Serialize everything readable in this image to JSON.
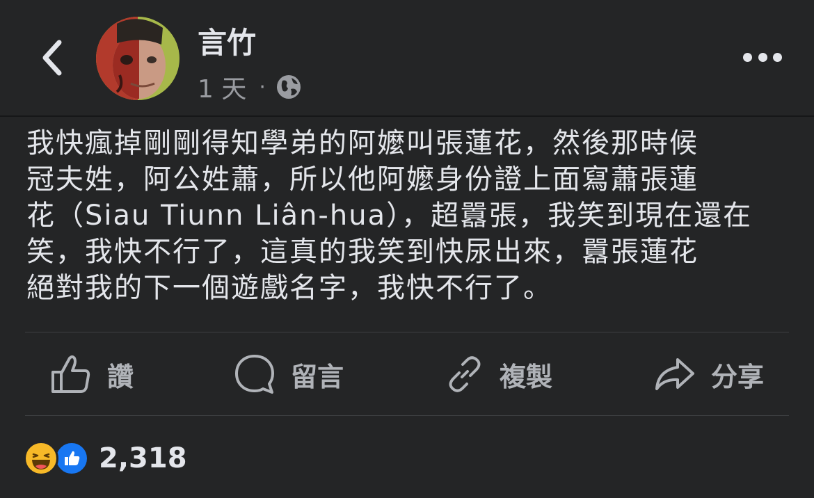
{
  "header": {
    "author": "言竹",
    "time": "1 天",
    "separator": "·",
    "audience_icon": "globe-icon"
  },
  "post": {
    "text": "我快瘋掉剛剛得知學弟的阿嬤叫張蓮花，然後那時候\n冠夫姓，阿公姓蕭，所以他阿嬤身份證上面寫蕭張蓮\n花（Siau Tiunn Liân-hua），超囂張，我笑到現在還在\n笑，我快不行了，這真的我笑到快尿出來，囂張蓮花\n絕對我的下一個遊戲名字，我快不行了。"
  },
  "actions": {
    "like": "讚",
    "comment": "留言",
    "copy": "複製",
    "share": "分享"
  },
  "reactions": {
    "count": "2,318",
    "icons": [
      "haha-icon",
      "like-icon"
    ],
    "colors": {
      "haha": "#f7b928",
      "like": "#1877f2"
    }
  }
}
